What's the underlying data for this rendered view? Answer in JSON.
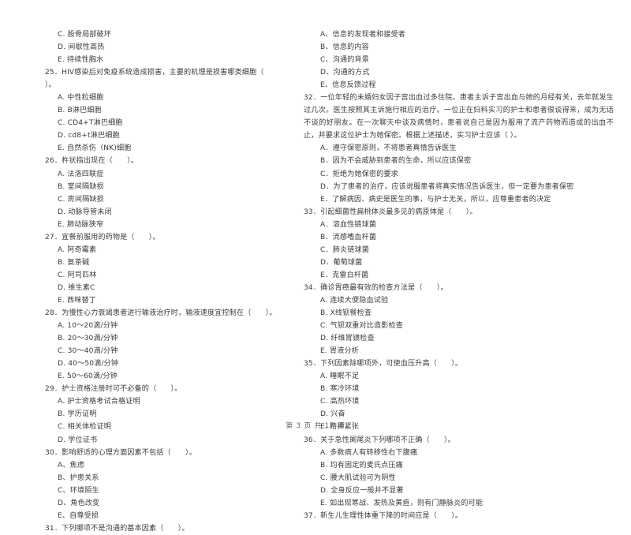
{
  "document": {
    "type": "exam-paper",
    "language": "zh-CN",
    "footer": "第 3 页 共 17 页",
    "page_number": "3",
    "total_pages": "17"
  },
  "left_column": {
    "continued_options": [
      "C. 股骨局部破坏",
      "D. 间歇性高热",
      "E. 持续性胸水"
    ],
    "questions": [
      {
        "number": "25",
        "stem": "25．HIV感染后对免疫系统造成损害，主要的机理是损害哪类细胞（      ）。",
        "options": [
          "A. 中性粒细胞",
          "B. B淋巴细胞",
          "C. CD4+T淋巴细胞",
          "D. cd8+t淋巴细胞",
          "E. 自然杀伤（NK)细胞"
        ]
      },
      {
        "number": "26",
        "stem": "26．杵状指出现在（      ）。",
        "options": [
          "A. 法洛四联症",
          "B. 室间隔缺损",
          "C. 房间隔缺损",
          "D. 动脉导管未闭",
          "E. 肺动脉狭窄"
        ]
      },
      {
        "number": "27",
        "stem": "27．宜餐前服用的药物是（      ）。",
        "options": [
          "A. 阿奇霉素",
          "B. 氨茶碱",
          "C. 阿司匹林",
          "D. 维生素C",
          "E. 西咪替丁"
        ]
      },
      {
        "number": "28",
        "stem": "28．为慢性心力衰竭患者进行输液治疗时，输液速度宜控制在（      ）。",
        "options": [
          "A. 10～20滴/分钟",
          "B. 20～30滴/分钟",
          "C. 30～40滴/分钟",
          "D. 40～50滴/分钟",
          "E. 50～60滴/分钟"
        ]
      },
      {
        "number": "29",
        "stem": "29．护士资格注册时可不必备的（      ）。",
        "options": [
          "A. 护士资格考试合格证明",
          "B. 学历证明",
          "C. 相关体检证明",
          "D. 学位证书"
        ]
      },
      {
        "number": "30",
        "stem": "30．影响舒适的心理方面因素不包括（      ）。",
        "options": [
          "A、焦虑",
          "B、护患关系",
          "C、环境陌生",
          "D、角色改变",
          "E、自尊受损"
        ]
      },
      {
        "number": "31",
        "stem": "31．下列哪项不是沟通的基本因素（      ）。",
        "options": []
      }
    ]
  },
  "right_column": {
    "continued_options": [
      "A、信息的发现者和接受者",
      "B、信息的内容",
      "C、沟通的背景",
      "D、沟通的方式",
      "E、信息反馈过程"
    ],
    "questions": [
      {
        "number": "32",
        "stem": "32．一位年轻的未婚妇女因子宫出血过多住院。患者主诉子宫出血与她的月经有关，去年就发生过几次。医生按照其主诉施行相应的治疗。一位正在妇科实习的护士和患者很谈得来，成为无话不谈的好朋友。在一次聊天中谈及病情时，患者说自己是因为服用了流产药物而造成的出血不止，并要求这位护士为她保密。根据上述描述，实习护士应该（      ）。",
        "options": [
          "A．遵守保密原则，不将患者真情告诉医生",
          "B．因为不会威胁到患者的生命，所以应该保密",
          "C．拒绝为她保密的要求",
          "D．为了患者的治疗，应该说服患者将真实情况告诉医生，但一定要为患者保密",
          "E．了解病因、病史是医生的事，与护士无关，所以，应尊重患者的决定"
        ]
      },
      {
        "number": "33",
        "stem": "33．引起细菌性扁桃体炎最多见的病原体是（      ）。",
        "options": [
          "A．溶血性链球菌",
          "B．流感嗜血杆菌",
          "C．肺炎链球菌",
          "D．葡萄球菌",
          "E．克雷白杆菌"
        ]
      },
      {
        "number": "34",
        "stem": "34．确诊胃癌最有效的检查方法是（      ）。",
        "options": [
          "A. 连续大便隐血试验",
          "B. X线钡餐检查",
          "C. 气钡双重对比造影检查",
          "D. 纤维胃镜检查",
          "E. 胃液分析"
        ]
      },
      {
        "number": "35",
        "stem": "35．下列因素除哪项外，可使血压升高（      ）。",
        "options": [
          "A. 睡眠不足",
          "B. 寒冷环境",
          "C. 高热环境",
          "D. 兴奋",
          "E. 精神紧张"
        ]
      },
      {
        "number": "36",
        "stem": "36．关于急性阑尾炎下列哪项不正确（      ）。",
        "options": [
          "A. 多数病人有转移性右下腹痛",
          "B. 均有固定的麦氏点压痛",
          "C. 腰大肌试验可为阴性",
          "D. 全身反应一般并不显著",
          "E. 如出现寒战、发热及黄疸，则有门静脉炎的可能"
        ]
      },
      {
        "number": "37",
        "stem": "37．新生儿生理性体重下降的时间应是（      ）。",
        "options": []
      }
    ]
  }
}
